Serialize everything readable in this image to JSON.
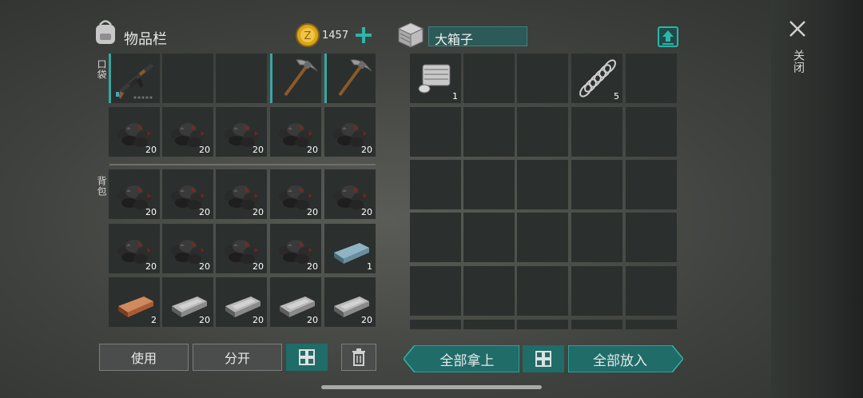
{
  "inventory": {
    "title": "物品栏",
    "coins": "1457",
    "pocket_label": "口袋",
    "backpack_label": "背包",
    "pocket": [
      {
        "item": "ak-rifle",
        "count": ""
      },
      {
        "item": "empty",
        "count": ""
      },
      {
        "item": "empty",
        "count": ""
      },
      {
        "item": "pickaxe",
        "count": ""
      },
      {
        "item": "pickaxe",
        "count": ""
      },
      {
        "item": "coal",
        "count": "20"
      },
      {
        "item": "coal",
        "count": "20"
      },
      {
        "item": "coal",
        "count": "20"
      },
      {
        "item": "coal",
        "count": "20"
      },
      {
        "item": "coal",
        "count": "20"
      }
    ],
    "backpack": [
      {
        "item": "coal",
        "count": "20"
      },
      {
        "item": "coal",
        "count": "20"
      },
      {
        "item": "coal",
        "count": "20"
      },
      {
        "item": "coal",
        "count": "20"
      },
      {
        "item": "coal",
        "count": "20"
      },
      {
        "item": "coal",
        "count": "20"
      },
      {
        "item": "coal",
        "count": "20"
      },
      {
        "item": "coal",
        "count": "20"
      },
      {
        "item": "coal",
        "count": "20"
      },
      {
        "item": "steel-ingot",
        "count": "1"
      },
      {
        "item": "copper-ingot",
        "count": "2"
      },
      {
        "item": "iron-ingot",
        "count": "20"
      },
      {
        "item": "iron-ingot",
        "count": "20"
      },
      {
        "item": "iron-ingot",
        "count": "20"
      },
      {
        "item": "iron-ingot",
        "count": "20"
      }
    ]
  },
  "chest": {
    "title": "大箱子",
    "slots": [
      {
        "item": "engine-part",
        "count": "1"
      },
      {
        "item": "empty",
        "count": ""
      },
      {
        "item": "empty",
        "count": ""
      },
      {
        "item": "spring",
        "count": "5"
      }
    ]
  },
  "buttons": {
    "use": "使用",
    "split": "分开",
    "take_all": "全部拿上",
    "put_all": "全部放入",
    "close": "关闭"
  },
  "colors": {
    "accent": "#3aa6a2",
    "coin": "#d9a51e"
  }
}
